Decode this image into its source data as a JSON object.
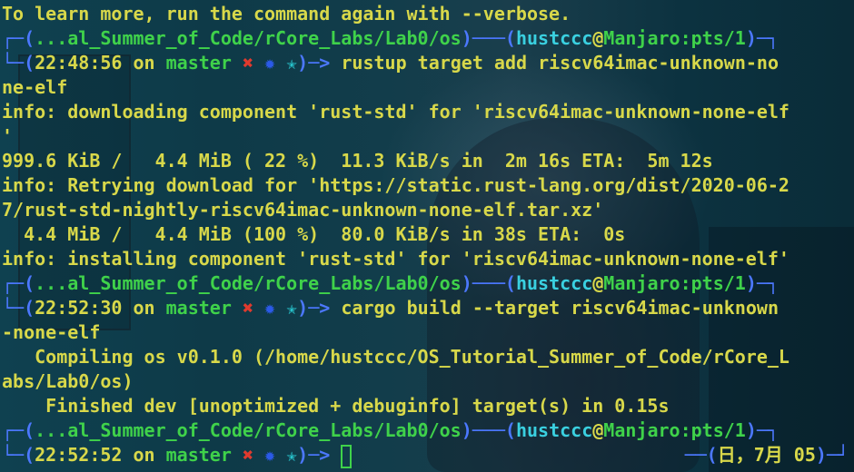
{
  "line1": "To learn more, run the command again with --verbose.",
  "prompt1": {
    "path": "...al_Summer_of_Code/rCore_Labs/Lab0/os",
    "user": "hustccc",
    "at": "@",
    "host": "Manjaro:pts/1",
    "time": "22:48:56",
    "on": "on",
    "branch": "master",
    "status_x": "✖",
    "status_gear": "✹",
    "status_star": "✭",
    "arrow": "─>",
    "cmd_a": "rustup target add riscv64imac-unknown-no",
    "cmd_b": "ne-elf"
  },
  "out": {
    "l1": "info: downloading component 'rust-std' for 'riscv64imac-unknown-none-elf",
    "l2": "'",
    "l3": "999.6 KiB /   4.4 MiB ( 22 %)  11.3 KiB/s in  2m 16s ETA:  5m 12s",
    "l4": "info: Retrying download for 'https://static.rust-lang.org/dist/2020-06-2",
    "l5": "7/rust-std-nightly-riscv64imac-unknown-none-elf.tar.xz'",
    "l6": "  4.4 MiB /   4.4 MiB (100 %)  80.0 KiB/s in 38s ETA:  0s",
    "l7": "info: installing component 'rust-std' for 'riscv64imac-unknown-none-elf'"
  },
  "prompt2": {
    "path": "...al_Summer_of_Code/rCore_Labs/Lab0/os",
    "user": "hustccc",
    "at": "@",
    "host": "Manjaro:pts/1",
    "time": "22:52:30",
    "on": "on",
    "branch": "master",
    "status_x": "✖",
    "status_gear": "✹",
    "status_star": "✭",
    "arrow": "─>",
    "cmd_a": "cargo build --target riscv64imac-unknown",
    "cmd_b": "-none-elf"
  },
  "out2": {
    "l1": "   Compiling os v0.1.0 (/home/hustccc/OS_Tutorial_Summer_of_Code/rCore_L",
    "l2": "abs/Lab0/os)",
    "l3": "    Finished dev [unoptimized + debuginfo] target(s) in 0.15s"
  },
  "prompt3": {
    "path": "...al_Summer_of_Code/rCore_Labs/Lab0/os",
    "user": "hustccc",
    "at": "@",
    "host": "Manjaro:pts/1",
    "time": "22:52:52",
    "on": "on",
    "branch": "master",
    "status_x": "✖",
    "status_gear": "✹",
    "status_star": "✭",
    "arrow": "─>",
    "date": "日，7月 05"
  },
  "colors": {
    "text": "#d8d84a",
    "green": "#3fd24a",
    "cyan": "#3ad0e0",
    "box": "#4c78ff",
    "red": "#e03a2e",
    "blue": "#2b5ae8"
  }
}
